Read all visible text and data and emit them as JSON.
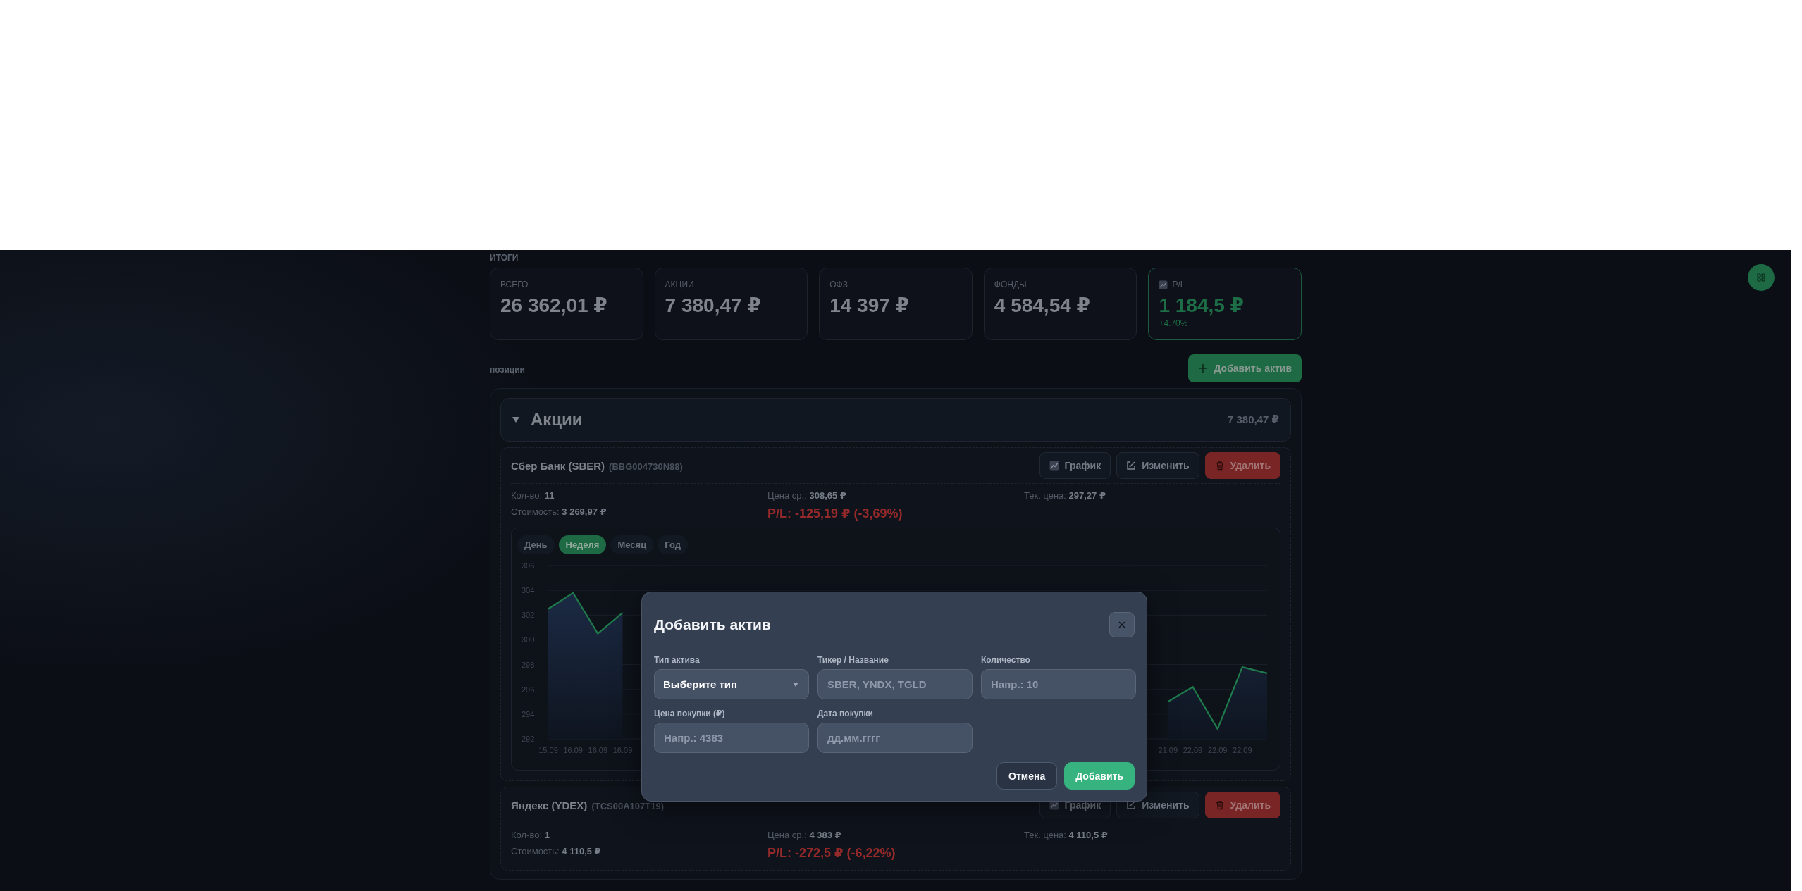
{
  "summary": {
    "title": "ИТОГИ",
    "cards": [
      {
        "label": "ВСЕГО",
        "value": "26 362,01 ₽",
        "kind": "plain"
      },
      {
        "label": "АКЦИИ",
        "value": "7 380,47 ₽",
        "kind": "plain"
      },
      {
        "label": "ОФЗ",
        "value": "14 397 ₽",
        "kind": "plain"
      },
      {
        "label": "ФОНДЫ",
        "value": "4 584,54 ₽",
        "kind": "plain"
      },
      {
        "label": "P/L",
        "value": "1 184,5 ₽",
        "change": "+4.70%",
        "kind": "profit"
      }
    ]
  },
  "positions": {
    "title": "позиции",
    "add_button": "Добавить актив",
    "groups": [
      {
        "name": "Акции",
        "total": "7 380,47 ₽",
        "expanded": true,
        "assets": [
          {
            "name": "Сбер Банк (SBER)",
            "code": "(BBG004730N88)",
            "quantity": "Кол-во: **11**",
            "cost": "Стоимость: **3 269,97 ₽**",
            "avg_price": "Цена ср.: **308,65 ₽**",
            "pl": "P/L: -125,19 ₽ (-3,69%)",
            "current_price": "Тек. цена: **297,27 ₽**",
            "actions": [
              {
                "label": "График",
                "kind": "chart"
              },
              {
                "label": "Изменить",
                "kind": "edit"
              },
              {
                "label": "Удалить",
                "kind": "delete"
              }
            ],
            "chart": {
              "periods": [
                {
                  "label": "День",
                  "selected": false
                },
                {
                  "label": "Неделя",
                  "selected": true
                },
                {
                  "label": "Месяц",
                  "selected": false
                },
                {
                  "label": "Год",
                  "selected": false
                }
              ],
              "chart_data": {
                "type": "area",
                "grid": true,
                "ylim": [
                  292,
                  306
                ],
                "yticks": [
                  292,
                  294,
                  296,
                  298,
                  300,
                  302,
                  304,
                  306
                ],
                "categories": [
                  "15.09",
                  "16.09",
                  "16.09",
                  "16.09",
                  null,
                  null,
                  null,
                  null,
                  null,
                  null,
                  null,
                  null,
                  null,
                  null,
                  null,
                  null,
                  null,
                  null,
                  null,
                  null,
                  null,
                  null,
                  null,
                  null,
                  null,
                  "21.09",
                  "22.09",
                  "22.09",
                  "22.09",
                  null
                ],
                "series": [
                  {
                    "color": "#1f7a4c",
                    "values": [
                      302.5,
                      303.8,
                      300.5,
                      302.2,
                      null,
                      null,
                      null,
                      null,
                      null,
                      null,
                      null,
                      null,
                      null,
                      null,
                      null,
                      null,
                      null,
                      null,
                      null,
                      null,
                      null,
                      null,
                      null,
                      null,
                      null,
                      295.0,
                      296.2,
                      292.8,
                      297.8,
                      297.3
                    ]
                  }
                ]
              }
            }
          },
          {
            "name": "Яндекс (YDEX)",
            "code": "(TCS00A107T19)",
            "quantity": "Кол-во: **1**",
            "cost": "Стоимость: **4 110,5 ₽**",
            "avg_price": "Цена ср.: **4 383 ₽**",
            "pl": "P/L: -272,5 ₽ (-6,22%)",
            "current_price": "Тек. цена: **4 110,5 ₽**",
            "actions": [
              {
                "label": "График",
                "kind": "chart"
              },
              {
                "label": "Изменить",
                "kind": "edit"
              },
              {
                "label": "Удалить",
                "kind": "delete"
              }
            ]
          }
        ]
      }
    ]
  },
  "modal": {
    "title": "Добавить актив",
    "fields": [
      {
        "label": "Тип актива",
        "kind": "select",
        "value": "Выберите тип"
      },
      {
        "label": "Тикер / Название",
        "kind": "input",
        "placeholder": "SBER, YNDX, TGLD"
      },
      {
        "label": "Количество",
        "kind": "input",
        "placeholder": "Напр.: 10"
      },
      {
        "label": "Цена покупки (₽)",
        "kind": "input",
        "placeholder": "Напр.: 4383"
      },
      {
        "label": "Дата покупки",
        "kind": "input",
        "placeholder": "дд.мм.гггг"
      }
    ],
    "cancel_button": "Отмена",
    "submit_button": "Добавить"
  }
}
